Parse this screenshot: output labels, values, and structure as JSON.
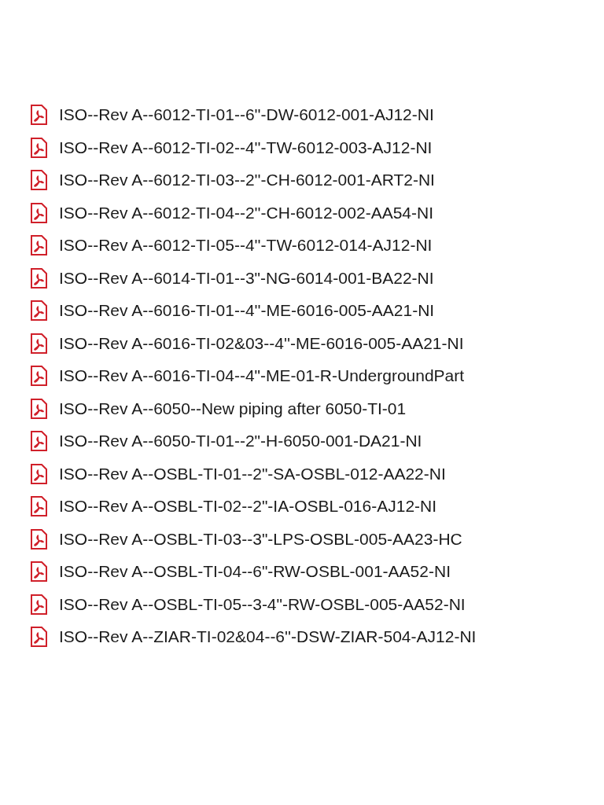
{
  "files": [
    {
      "name": "ISO--Rev A--6012-TI-01--6''-DW-6012-001-AJ12-NI"
    },
    {
      "name": "ISO--Rev A--6012-TI-02--4''-TW-6012-003-AJ12-NI"
    },
    {
      "name": "ISO--Rev A--6012-TI-03--2''-CH-6012-001-ART2-NI"
    },
    {
      "name": "ISO--Rev A--6012-TI-04--2''-CH-6012-002-AA54-NI"
    },
    {
      "name": "ISO--Rev A--6012-TI-05--4''-TW-6012-014-AJ12-NI"
    },
    {
      "name": "ISO--Rev A--6014-TI-01--3\"-NG-6014-001-BA22-NI"
    },
    {
      "name": "ISO--Rev A--6016-TI-01--4''-ME-6016-005-AA21-NI"
    },
    {
      "name": "ISO--Rev A--6016-TI-02&03--4''-ME-6016-005-AA21-NI"
    },
    {
      "name": "ISO--Rev A--6016-TI-04--4\"-ME-01-R-UndergroundPart"
    },
    {
      "name": "ISO--Rev A--6050--New piping after 6050-TI-01"
    },
    {
      "name": "ISO--Rev A--6050-TI-01--2\"-H-6050-001-DA21-NI"
    },
    {
      "name": "ISO--Rev A--OSBL-TI-01--2\"-SA-OSBL-012-AA22-NI"
    },
    {
      "name": "ISO--Rev A--OSBL-TI-02--2\"-IA-OSBL-016-AJ12-NI"
    },
    {
      "name": "ISO--Rev A--OSBL-TI-03--3\"-LPS-OSBL-005-AA23-HC"
    },
    {
      "name": "ISO--Rev A--OSBL-TI-04--6\"-RW-OSBL-001-AA52-NI"
    },
    {
      "name": "ISO--Rev A--OSBL-TI-05--3-4\"-RW-OSBL-005-AA52-NI"
    },
    {
      "name": "ISO--Rev A--ZIAR-TI-02&04--6''-DSW-ZIAR-504-AJ12-NI"
    }
  ]
}
